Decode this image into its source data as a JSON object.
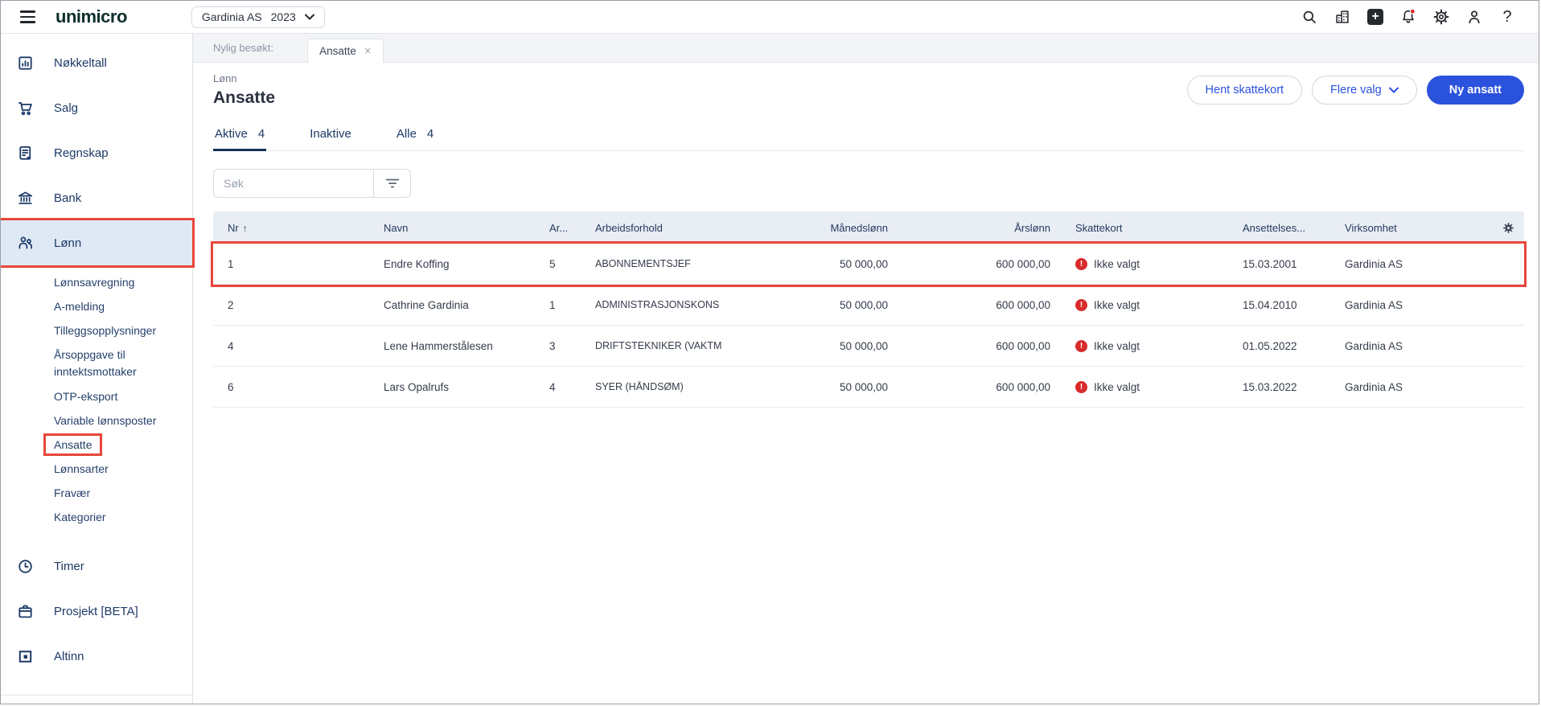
{
  "topbar": {
    "logo": "unimicro",
    "company_selector": {
      "company": "Gardinia AS",
      "year": "2023"
    },
    "icon_names": [
      "search",
      "companies",
      "add",
      "notifications",
      "settings",
      "profile",
      "help"
    ],
    "help_glyph": "?",
    "add_glyph": "+"
  },
  "sidebar": {
    "items": [
      {
        "label": "Nøkkeltall",
        "icon": "bar-chart"
      },
      {
        "label": "Salg",
        "icon": "cart"
      },
      {
        "label": "Regnskap",
        "icon": "ledger"
      },
      {
        "label": "Bank",
        "icon": "bank"
      },
      {
        "label": "Lønn",
        "icon": "people",
        "active": true,
        "annotated": true
      },
      {
        "label": "Timer",
        "icon": "clock"
      },
      {
        "label": "Prosjekt [BETA]",
        "icon": "briefcase"
      },
      {
        "label": "Altinn",
        "icon": "altinn"
      }
    ],
    "lonn_submenu": [
      {
        "label": "Lønnsavregning"
      },
      {
        "label": "A-melding"
      },
      {
        "label": "Tilleggsopplysninger"
      },
      {
        "label": "Årsoppgave til inntektsmottaker"
      },
      {
        "label": "OTP-eksport"
      },
      {
        "label": "Variable lønnsposter"
      },
      {
        "label": "Ansatte",
        "annotated": true
      },
      {
        "label": "Lønnsarter"
      },
      {
        "label": "Fravær"
      },
      {
        "label": "Kategorier"
      }
    ]
  },
  "recent": {
    "label": "Nylig besøkt:",
    "tab": "Ansatte",
    "close_glyph": "×"
  },
  "page": {
    "overline": "Lønn",
    "title": "Ansatte",
    "actions": {
      "secondary1": "Hent skattekort",
      "secondary2": "Flere valg",
      "primary": "Ny ansatt"
    }
  },
  "view_tabs": [
    {
      "label": "Aktive",
      "count": "4",
      "active": true
    },
    {
      "label": "Inaktive"
    },
    {
      "label": "Alle",
      "count": "4"
    }
  ],
  "search": {
    "placeholder": "Søk"
  },
  "table": {
    "sort_glyph": "↑",
    "alert_glyph": "!",
    "columns": {
      "nr": "Nr",
      "navn": "Navn",
      "ar": "Ar...",
      "arbeidsforhold": "Arbeidsforhold",
      "manedslonn": "Månedslønn",
      "arslonn": "Årslønn",
      "skattekort": "Skattekort",
      "ansettelses": "Ansettelses...",
      "virksomhet": "Virksomhet"
    },
    "rows": [
      {
        "nr": "1",
        "navn": "Endre Koffing",
        "ar": "5",
        "arbeidsforhold": "ABONNEMENTSJEF",
        "manedslonn": "50 000,00",
        "arslonn": "600 000,00",
        "skattekort": "Ikke valgt",
        "ansettelses": "15.03.2001",
        "virksomhet": "Gardinia AS",
        "annotated": true
      },
      {
        "nr": "2",
        "navn": "Cathrine Gardinia",
        "ar": "1",
        "arbeidsforhold": "ADMINISTRASJONSKONS",
        "manedslonn": "50 000,00",
        "arslonn": "600 000,00",
        "skattekort": "Ikke valgt",
        "ansettelses": "15.04.2010",
        "virksomhet": "Gardinia AS"
      },
      {
        "nr": "4",
        "navn": "Lene Hammerstålesen",
        "ar": "3",
        "arbeidsforhold": "DRIFTSTEKNIKER (VAKTM",
        "manedslonn": "50 000,00",
        "arslonn": "600 000,00",
        "skattekort": "Ikke valgt",
        "ansettelses": "01.05.2022",
        "virksomhet": "Gardinia AS"
      },
      {
        "nr": "6",
        "navn": "Lars Opalrufs",
        "ar": "4",
        "arbeidsforhold": "SYER (HÅNDSØM)",
        "manedslonn": "50 000,00",
        "arslonn": "600 000,00",
        "skattekort": "Ikke valgt",
        "ansettelses": "15.03.2022",
        "virksomhet": "Gardinia AS"
      }
    ]
  },
  "colors": {
    "accent_blue": "#2B52DD",
    "annotation_red": "#E8463A",
    "alert_red": "#D92B2B",
    "sidebar_navy": "#1C3A68",
    "table_header_bg": "#E9EDF4",
    "active_item_bg": "#DFE8F5",
    "notification_dot": "#E11B22"
  }
}
